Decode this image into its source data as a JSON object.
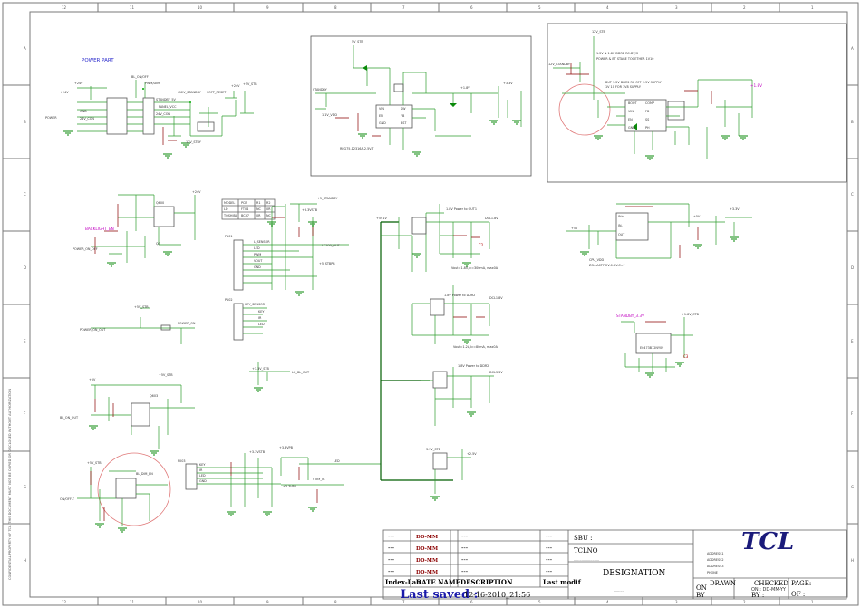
{
  "sheet": {
    "power_part_label": "POWER PART",
    "company_logo": "TCL",
    "last_saved_label": "Last saved :",
    "last_saved_value": "12-16-2010_21:56"
  },
  "title_block": {
    "rows": [
      {
        "index": "---",
        "dd": "DD-MM",
        "name": "---",
        "desc": "---",
        "mod": "---"
      },
      {
        "index": "---",
        "dd": "DD-MM",
        "name": "---",
        "desc": "---",
        "mod": "---"
      },
      {
        "index": "---",
        "dd": "DD-MM",
        "name": "---",
        "desc": "---",
        "mod": "---"
      },
      {
        "index": "---",
        "dd": "DD-MM",
        "name": "---",
        "desc": "---",
        "mod": "---"
      }
    ],
    "header": {
      "index": "Index-Lab",
      "date": "DATE",
      "name": "NAME",
      "desc": "DESCRIPTION",
      "mod": "Last modif"
    },
    "sbu_label": "SBU :",
    "tclno_label": "TCLNO",
    "tclno_dots": "..........................",
    "designation_label": "DESIGNATION",
    "designation_dots": "..........",
    "addresses": [
      "ADDRESS1",
      "ADDRESS2",
      "ADDRESS3",
      "PHONE"
    ],
    "drawn_label": "DRAWN",
    "on_label": "ON",
    "by_label": "BY",
    "checked_label": "CHECKED",
    "checked_on": "ON : DD-MM-YY",
    "checked_by": "BY :",
    "page_label": "PAGE:",
    "of_label": "OF :"
  },
  "rulers": {
    "top": [
      "12",
      "11",
      "10",
      "9",
      "8",
      "7",
      "6",
      "5",
      "4",
      "3",
      "2",
      "1"
    ],
    "bottom": [
      "12",
      "11",
      "10",
      "9",
      "8",
      "7",
      "6",
      "5",
      "4",
      "3",
      "2",
      "1"
    ],
    "left": [
      "A",
      "B",
      "C",
      "D",
      "E",
      "F",
      "G",
      "H"
    ],
    "right": [
      "A",
      "B",
      "C",
      "D",
      "E",
      "F",
      "G",
      "H"
    ]
  },
  "side_note": "CONFIDENTIAL PROPERTY OF TCL. THIS DOCUMENT MUST NOT BE COPIED OR DISCLOSED WITHOUT AUTHORIZATION",
  "colors": {
    "wire": "#2f9e2f",
    "bus": "#005d00",
    "ground": "#0a8a0a",
    "highlight_circle": "#e07a7a",
    "net_label": "#c000c0",
    "title_blue": "#2a2acc",
    "logo": "#1a1a7a"
  }
}
